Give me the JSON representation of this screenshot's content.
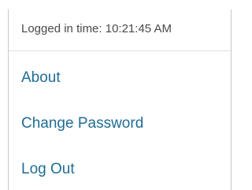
{
  "session": {
    "logged_in_time": "Logged in time: 10:21:45 AM"
  },
  "menu": {
    "about": "About",
    "change_password": "Change Password",
    "log_out": "Log Out"
  },
  "colors": {
    "link": "#1f6c93",
    "text": "#4a4a4a",
    "border": "#c8c8c8"
  }
}
